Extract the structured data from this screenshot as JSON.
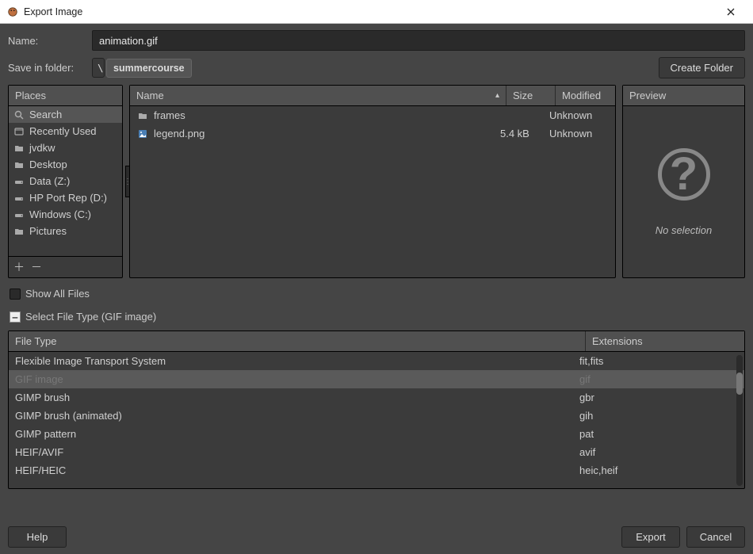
{
  "window": {
    "title": "Export Image"
  },
  "name_row": {
    "label": "Name:",
    "value": "animation.gif"
  },
  "folder_row": {
    "label": "Save in folder:",
    "crumbs": [
      {
        "text": "\\",
        "active": false
      },
      {
        "text": "summercourse",
        "active": true
      }
    ],
    "create_folder_label": "Create Folder"
  },
  "places": {
    "header": "Places",
    "items": [
      {
        "icon": "search",
        "label": "Search"
      },
      {
        "icon": "recent",
        "label": "Recently Used"
      },
      {
        "icon": "folder",
        "label": "jvdkw"
      },
      {
        "icon": "folder",
        "label": "Desktop"
      },
      {
        "icon": "drive",
        "label": "Data (Z:)"
      },
      {
        "icon": "drive",
        "label": "HP Port Rep (D:)"
      },
      {
        "icon": "drive",
        "label": "Windows (C:)"
      },
      {
        "icon": "folder",
        "label": "Pictures"
      }
    ]
  },
  "file_list": {
    "columns": {
      "name": "Name",
      "size": "Size",
      "modified": "Modified"
    },
    "rows": [
      {
        "icon": "folder",
        "name": "frames",
        "size": "",
        "modified": "Unknown"
      },
      {
        "icon": "image",
        "name": "legend.png",
        "size": "5.4 kB",
        "modified": "Unknown"
      }
    ]
  },
  "preview": {
    "header": "Preview",
    "status": "No selection"
  },
  "show_all": {
    "label": "Show All Files"
  },
  "select_file_type": {
    "label": "Select File Type (GIF image)"
  },
  "file_types": {
    "columns": {
      "name": "File Type",
      "ext": "Extensions"
    },
    "rows": [
      {
        "name": "Flexible Image Transport System",
        "ext": "fit,fits",
        "selected": false
      },
      {
        "name": "GIF image",
        "ext": "gif",
        "selected": true
      },
      {
        "name": "GIMP brush",
        "ext": "gbr",
        "selected": false
      },
      {
        "name": "GIMP brush (animated)",
        "ext": "gih",
        "selected": false
      },
      {
        "name": "GIMP pattern",
        "ext": "pat",
        "selected": false
      },
      {
        "name": "HEIF/AVIF",
        "ext": "avif",
        "selected": false
      },
      {
        "name": "HEIF/HEIC",
        "ext": "heic,heif",
        "selected": false
      }
    ]
  },
  "buttons": {
    "help": "Help",
    "export": "Export",
    "cancel": "Cancel"
  }
}
